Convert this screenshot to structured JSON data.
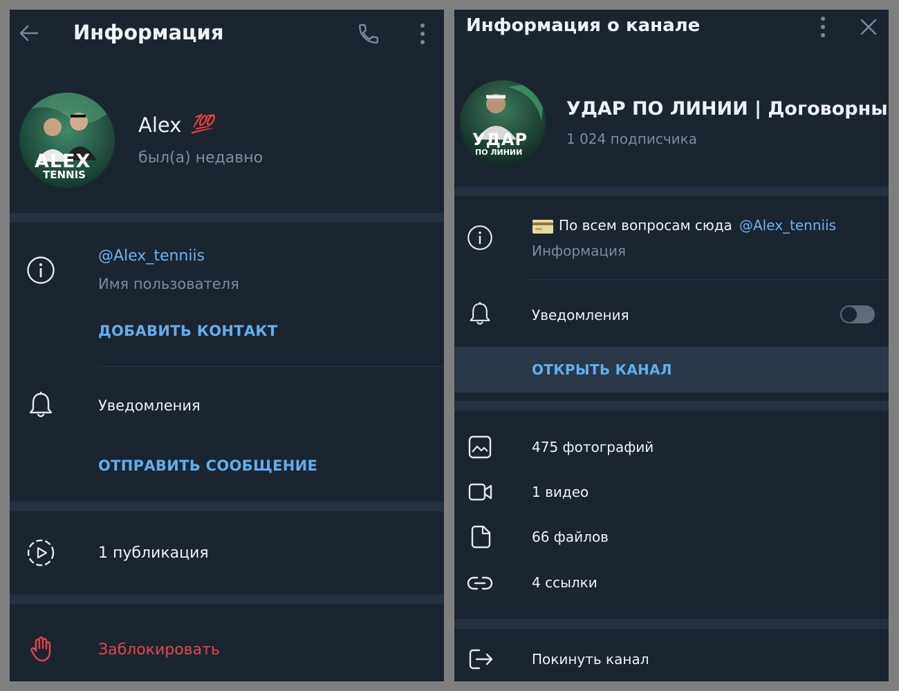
{
  "left": {
    "header": {
      "title": "Информация"
    },
    "profile": {
      "name": "Alex",
      "emoji": "💯",
      "status": "был(а) недавно",
      "avatar_line1": "ALEX",
      "avatar_line2": "TENNIS"
    },
    "info": {
      "username": "@Alex_tenniis",
      "username_label": "Имя пользователя",
      "add_contact": "ДОБАВИТЬ КОНТАКТ"
    },
    "notifications": {
      "label": "Уведомления",
      "send_message": "ОТПРАВИТЬ СООБЩЕНИЕ"
    },
    "publications": "1 публикация",
    "block": "Заблокировать"
  },
  "right": {
    "header": {
      "title": "Информация о канале"
    },
    "channel": {
      "name": "УДАР ПО ЛИНИИ | Договорны...",
      "subscribers": "1 024 подписчика",
      "avatar_line1": "УДАР",
      "avatar_line2": "ПО ЛИНИИ"
    },
    "info": {
      "description_prefix": "По всем вопросам сюда",
      "description_link": "@Alex_tenniis",
      "description_label": "Информация"
    },
    "notifications": {
      "label": "Уведомления",
      "enabled": false
    },
    "open_channel": "ОТКРЫТЬ КАНАЛ",
    "media": {
      "photos": "475 фотографий",
      "videos": "1 видео",
      "files": "66 файлов",
      "links": "4 ссылки"
    },
    "leave": "Покинуть канал"
  },
  "colors": {
    "panel_bg": "#1b2530",
    "separator": "#243140",
    "accent": "#62aeea",
    "danger": "#e0454a",
    "muted": "#7f8b97"
  }
}
